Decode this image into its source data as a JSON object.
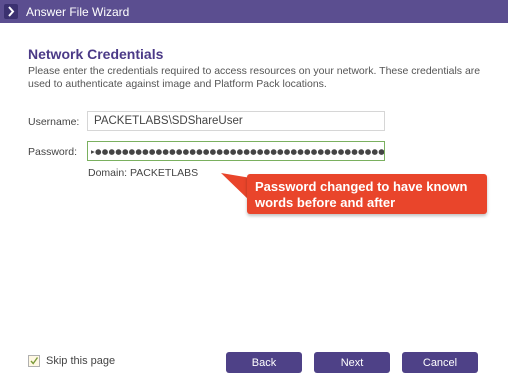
{
  "window": {
    "title": "Answer File Wizard"
  },
  "page": {
    "heading": "Network Credentials",
    "description": "Please enter the credentials required to access resources on your network. These credentials are used to authenticate against image and Platform Pack locations."
  },
  "form": {
    "username_label": "Username:",
    "username_value": "PACKETLABS\\SDShareUser",
    "password_label": "Password:",
    "password_value": "▸●●●●●●●●●●●●●●●●●●●●●●●●●●●●●●●●●●●●●●●●●●●●●●●●",
    "domain_text": "Domain: PACKETLABS"
  },
  "annotation": {
    "text": "Password changed to have known words before and after",
    "color": "#e9452b"
  },
  "footer": {
    "skip_label": "Skip this page",
    "skip_checked": true,
    "back_label": "Back",
    "next_label": "Next",
    "cancel_label": "Cancel"
  },
  "colors": {
    "titlebar": "#5b4e90",
    "heading": "#4b3a87",
    "button": "#4e4187",
    "password_border": "#7ab05f"
  },
  "icons": {
    "app": "wizard-app-icon",
    "checkbox": "checkmark-icon"
  }
}
